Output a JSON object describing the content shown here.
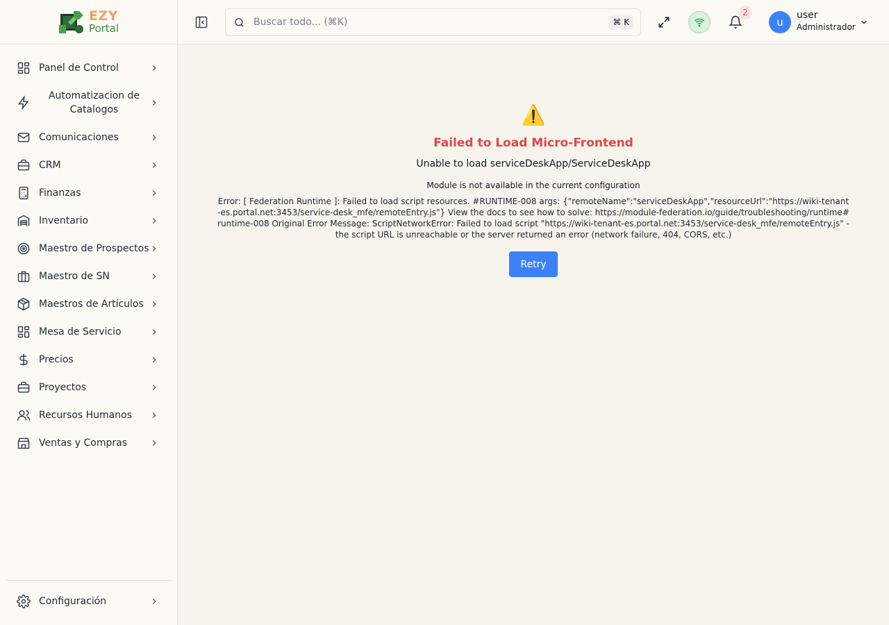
{
  "brand": {
    "line1": "EZY",
    "line2": "Portal"
  },
  "nav": {
    "items": [
      {
        "label": "Panel de Control",
        "icon": "dashboard-icon"
      },
      {
        "label": "Automatizacion de Catalogos",
        "icon": "lightning-icon"
      },
      {
        "label": "Comunicaciones",
        "icon": "mail-icon"
      },
      {
        "label": "CRM",
        "icon": "briefcase-icon"
      },
      {
        "label": "Finanzas",
        "icon": "calculator-icon"
      },
      {
        "label": "Inventario",
        "icon": "warehouse-icon"
      },
      {
        "label": "Maestro de Prospectos",
        "icon": "target-icon"
      },
      {
        "label": "Maestro de SN",
        "icon": "building-icon"
      },
      {
        "label": "Maestros de Artículos",
        "icon": "package-icon"
      },
      {
        "label": "Mesa de Servicio",
        "icon": "grid-icon"
      },
      {
        "label": "Precios",
        "icon": "dollar-icon"
      },
      {
        "label": "Proyectos",
        "icon": "briefcase-icon"
      },
      {
        "label": "Recursos Humanos",
        "icon": "users-icon"
      },
      {
        "label": "Ventas y Compras",
        "icon": "store-icon"
      }
    ],
    "settings_label": "Configuración"
  },
  "header": {
    "search_placeholder": "Buscar todo... (⌘K)",
    "shortcut": "⌘ K",
    "notification_count": "2",
    "user": {
      "initial": "u",
      "name": "user",
      "role": "Administrador"
    }
  },
  "error": {
    "icon": "⚠️",
    "title": "Failed to Load Micro-Frontend",
    "subtitle": "Unable to load serviceDeskApp/ServiceDeskApp",
    "module_message": "Module is not available in the current configuration",
    "details": "Error: [ Federation Runtime ]: Failed to load script resources. #RUNTIME-008 args: {\"remoteName\":\"serviceDeskApp\",\"resourceUrl\":\"https://wiki-tenant-es.portal.net:3453/service-desk_mfe/remoteEntry.js\"} View the docs to see how to solve: https://module-federation.io/guide/troubleshooting/runtime#runtime-008 Original Error Message: ScriptNetworkError: Failed to load script \"https://wiki-tenant-es.portal.net:3453/service-desk_mfe/remoteEntry.js\" - the script URL is unreachable or the server returned an error (network failure, 404, CORS, etc.)",
    "retry_label": "Retry"
  },
  "colors": {
    "accent": "#3b82f6",
    "error": "#e04646",
    "online": "#22a447"
  }
}
